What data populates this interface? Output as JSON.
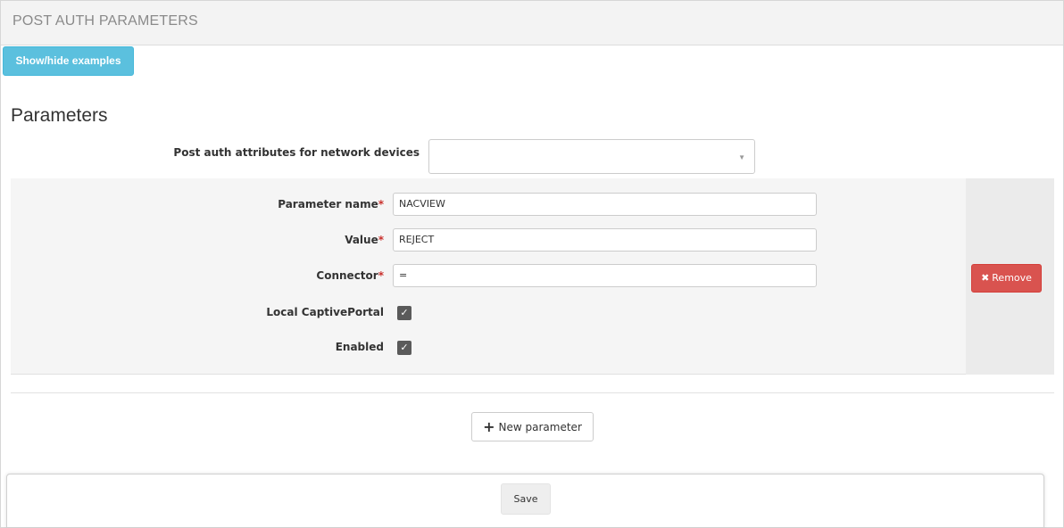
{
  "header": {
    "title": "POST AUTH PARAMETERS"
  },
  "toolbar": {
    "show_hide_label": "Show/hide examples"
  },
  "section": {
    "title": "Parameters"
  },
  "network_devices": {
    "label": "Post auth attributes for network devices",
    "selected": ""
  },
  "parameter": {
    "name_label": "Parameter name",
    "name_value": "NACVIEW",
    "value_label": "Value",
    "value_value": "REJECT",
    "connector_label": "Connector",
    "connector_value": "=",
    "captive_label": "Local CaptivePortal",
    "captive_checked": true,
    "enabled_label": "Enabled",
    "enabled_checked": true,
    "required_mark": "*",
    "remove_label": "Remove"
  },
  "actions": {
    "new_parameter_label": "New parameter",
    "save_label": "Save"
  },
  "colors": {
    "info": "#5bc0de",
    "danger": "#d9534f",
    "required": "#c9302c"
  }
}
